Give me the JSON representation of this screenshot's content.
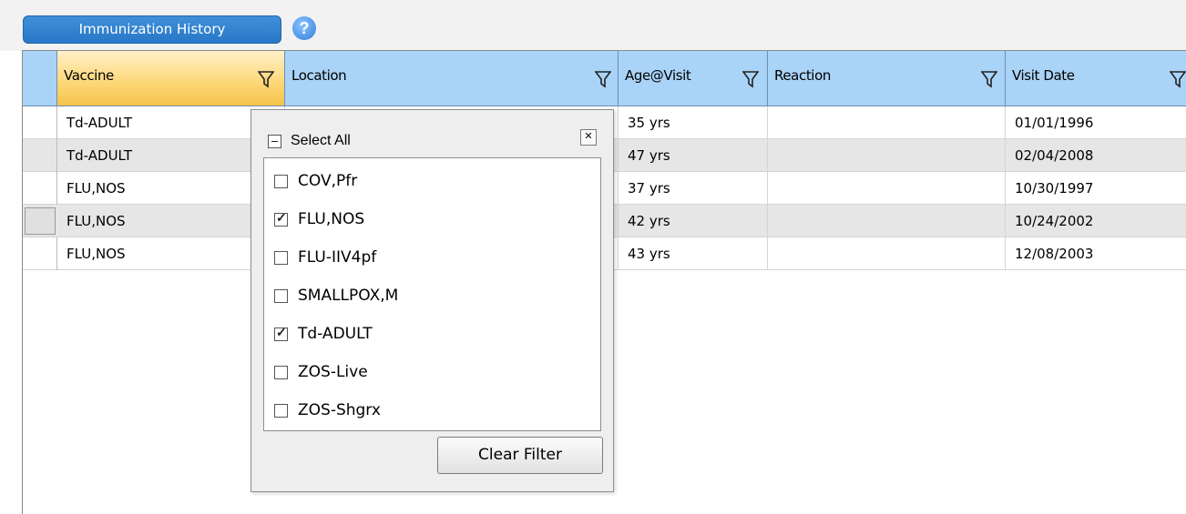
{
  "section": {
    "title": "Immunization History",
    "help_icon": "question-circle-icon"
  },
  "table": {
    "columns": [
      {
        "label": "Vaccine",
        "active": true
      },
      {
        "label": "Location",
        "active": false
      },
      {
        "label": "Age@Visit",
        "active": false
      },
      {
        "label": "Reaction",
        "active": false
      },
      {
        "label": "Visit Date",
        "active": false
      }
    ],
    "rows": [
      {
        "vaccine": "Td-ADULT",
        "location": "",
        "age": "35 yrs",
        "reaction": "",
        "visit_date": "01/01/1996"
      },
      {
        "vaccine": "Td-ADULT",
        "location": "",
        "age": "47 yrs",
        "reaction": "",
        "visit_date": "02/04/2008"
      },
      {
        "vaccine": "FLU,NOS",
        "location": "",
        "age": "37 yrs",
        "reaction": "",
        "visit_date": "10/30/1997"
      },
      {
        "vaccine": "FLU,NOS",
        "location": "",
        "age": "42 yrs",
        "reaction": "",
        "visit_date": "10/24/2002"
      },
      {
        "vaccine": "FLU,NOS",
        "location": "",
        "age": "43 yrs",
        "reaction": "",
        "visit_date": "12/08/2003"
      }
    ]
  },
  "filter_popup": {
    "select_all_label": "Select All",
    "close_icon": "close-x-icon",
    "options": [
      {
        "label": "COV,Pfr",
        "checked": false
      },
      {
        "label": "FLU,NOS",
        "checked": true
      },
      {
        "label": "FLU-IIV4pf",
        "checked": false
      },
      {
        "label": "SMALLPOX,M",
        "checked": false
      },
      {
        "label": "Td-ADULT",
        "checked": true
      },
      {
        "label": "ZOS-Live",
        "checked": false
      },
      {
        "label": "ZOS-Shgrx",
        "checked": false
      }
    ],
    "clear_filter_label": "Clear Filter"
  }
}
